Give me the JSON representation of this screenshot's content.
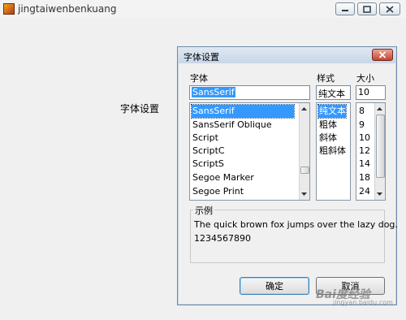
{
  "window": {
    "title": "jingtaiwenbenkuang"
  },
  "main": {
    "label": "字体设置"
  },
  "dialog": {
    "title": "字体设置",
    "font": {
      "label": "字体",
      "value": "SansSerif",
      "items": [
        "SansSerif",
        "SansSerif Oblique",
        "Script",
        "ScriptC",
        "ScriptS",
        "Segoe Marker",
        "Segoe Print"
      ],
      "selected": 0
    },
    "style": {
      "label": "样式",
      "value": "纯文本",
      "items": [
        "纯文本",
        "粗体",
        "斜体",
        "粗斜体"
      ],
      "selected": 0
    },
    "size": {
      "label": "大小",
      "value": "10",
      "items": [
        "8",
        "9",
        "10",
        "12",
        "14",
        "18",
        "24"
      ]
    },
    "sample": {
      "label": "示例",
      "line1": "The quick brown fox jumps over the lazy dog.",
      "line2": "1234567890"
    },
    "ok_label": "确定",
    "cancel_label": "取消"
  },
  "watermark": {
    "text": "Bai度经验",
    "sub": "jingyan.baidu.com"
  },
  "colors": {
    "selection": "#3399ff",
    "close_button": "#c8432e"
  }
}
